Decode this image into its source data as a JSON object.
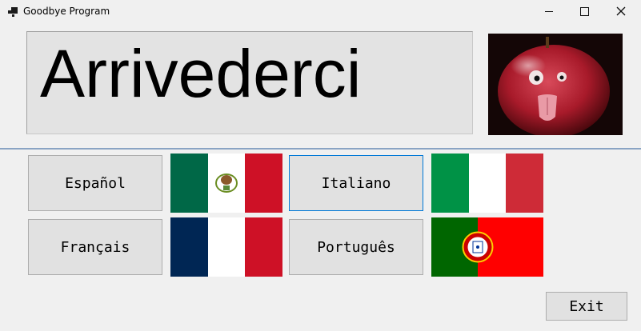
{
  "window": {
    "title": "Goodbye Program",
    "controls": [
      "minimize-icon",
      "maximize-icon",
      "close-icon"
    ]
  },
  "display": {
    "word": "Arrivederci",
    "image": "apple-face-photo"
  },
  "buttons": {
    "espanol": "Español",
    "italiano": "Italiano",
    "francais": "Français",
    "portugues": "Português",
    "exit": "Exit"
  },
  "flags": [
    "mexico-flag",
    "italy-flag",
    "france-flag",
    "portugal-flag"
  ],
  "focused_button": "Italiano",
  "colors": {
    "background": "#f0f0f0",
    "focus_border": "#0078d7",
    "separator": "#8aa4c4"
  }
}
